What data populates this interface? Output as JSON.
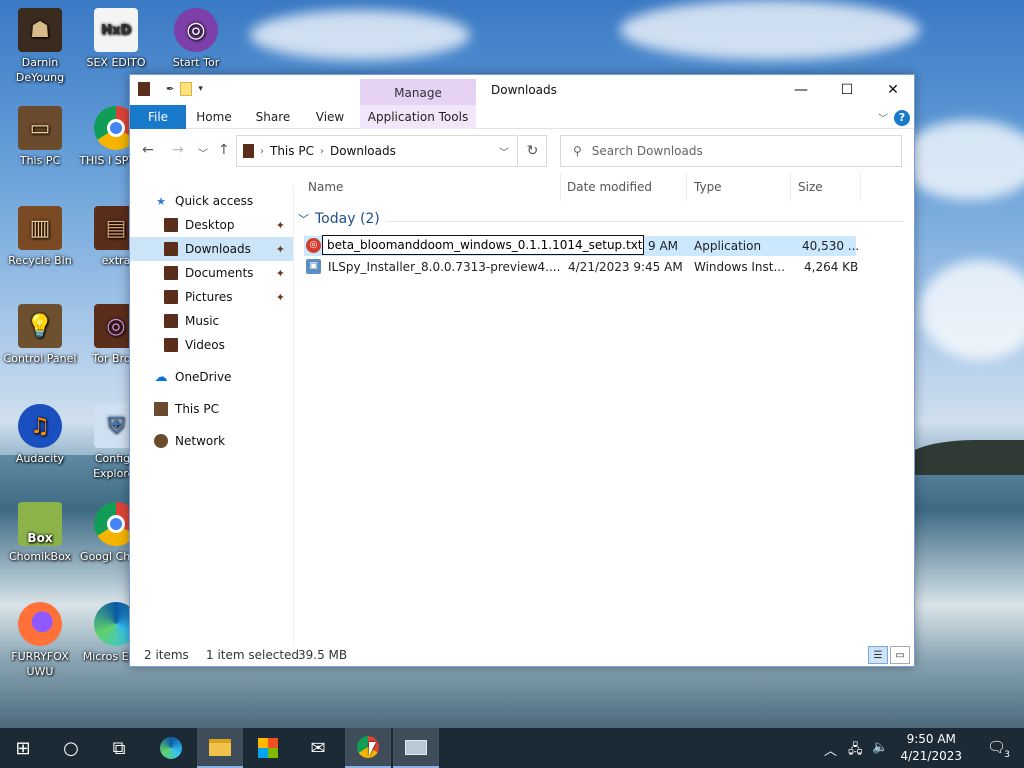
{
  "desktop": {
    "icons": [
      {
        "label": "Darnin DeYoung",
        "icon": "person-figure-icon"
      },
      {
        "label": "SEX EDITO",
        "icon": "hxd-editor-icon"
      },
      {
        "label": "Start Tor",
        "icon": "tor-onion-icon"
      },
      {
        "label": "This PC",
        "icon": "computer-icon"
      },
      {
        "label": "THIS I SPYWA",
        "icon": "chrome-icon"
      },
      {
        "label": "Recycle Bin",
        "icon": "recycle-bin-icon"
      },
      {
        "label": "extra",
        "icon": "folder-icon"
      },
      {
        "label": "Control Panel",
        "icon": "control-panel-icon"
      },
      {
        "label": "Tor Brow",
        "icon": "tor-browser-icon"
      },
      {
        "label": "Audacity",
        "icon": "audacity-icon"
      },
      {
        "label": "Configu Explorer",
        "icon": "shield-icon"
      },
      {
        "label": "ChomikBox",
        "icon": "chomikbox-icon"
      },
      {
        "label": "Googl Chrom",
        "icon": "chrome-icon"
      },
      {
        "label": "FURRYFOX UWU",
        "icon": "firefox-icon"
      },
      {
        "label": "Micros Edge",
        "icon": "edge-icon"
      }
    ],
    "chomik_box_text": "Box",
    "hxd_text": "HxD"
  },
  "window": {
    "title": "Downloads",
    "manage_tab": "Manage",
    "ribbon_tabs": [
      "File",
      "Home",
      "Share",
      "View",
      "Application Tools"
    ],
    "help_label": "?",
    "controls": {
      "minimize": "—",
      "maximize": "☐",
      "close": "✕"
    },
    "address": {
      "root": "This PC",
      "folder": "Downloads"
    },
    "search_placeholder": "Search Downloads"
  },
  "sidebar": {
    "quick_access": "Quick access",
    "items": [
      {
        "label": "Desktop",
        "pinned": true
      },
      {
        "label": "Downloads",
        "pinned": true,
        "selected": true
      },
      {
        "label": "Documents",
        "pinned": true
      },
      {
        "label": "Pictures",
        "pinned": true
      },
      {
        "label": "Music",
        "pinned": false
      },
      {
        "label": "Videos",
        "pinned": false
      }
    ],
    "onedrive": "OneDrive",
    "this_pc": "This PC",
    "network": "Network"
  },
  "content": {
    "columns": [
      "Name",
      "Date modified",
      "Type",
      "Size"
    ],
    "group": "Today (2)",
    "files": [
      {
        "rename_value": "beta_bloomanddoom_windows_0.1.1.1014_setup.txt",
        "date": "9 AM",
        "type": "Application",
        "size": "40,530 ..."
      },
      {
        "name": "ILSpy_Installer_8.0.0.7313-preview4....",
        "date": "4/21/2023 9:45 AM",
        "type": "Windows Inst...",
        "size": "4,264 KB"
      }
    ]
  },
  "status": {
    "count": "2 items",
    "selected": "1 item selected",
    "size": "39.5 MB"
  },
  "taskbar": {
    "time": "9:50 AM",
    "date": "4/21/2023",
    "notification_count": "3"
  }
}
